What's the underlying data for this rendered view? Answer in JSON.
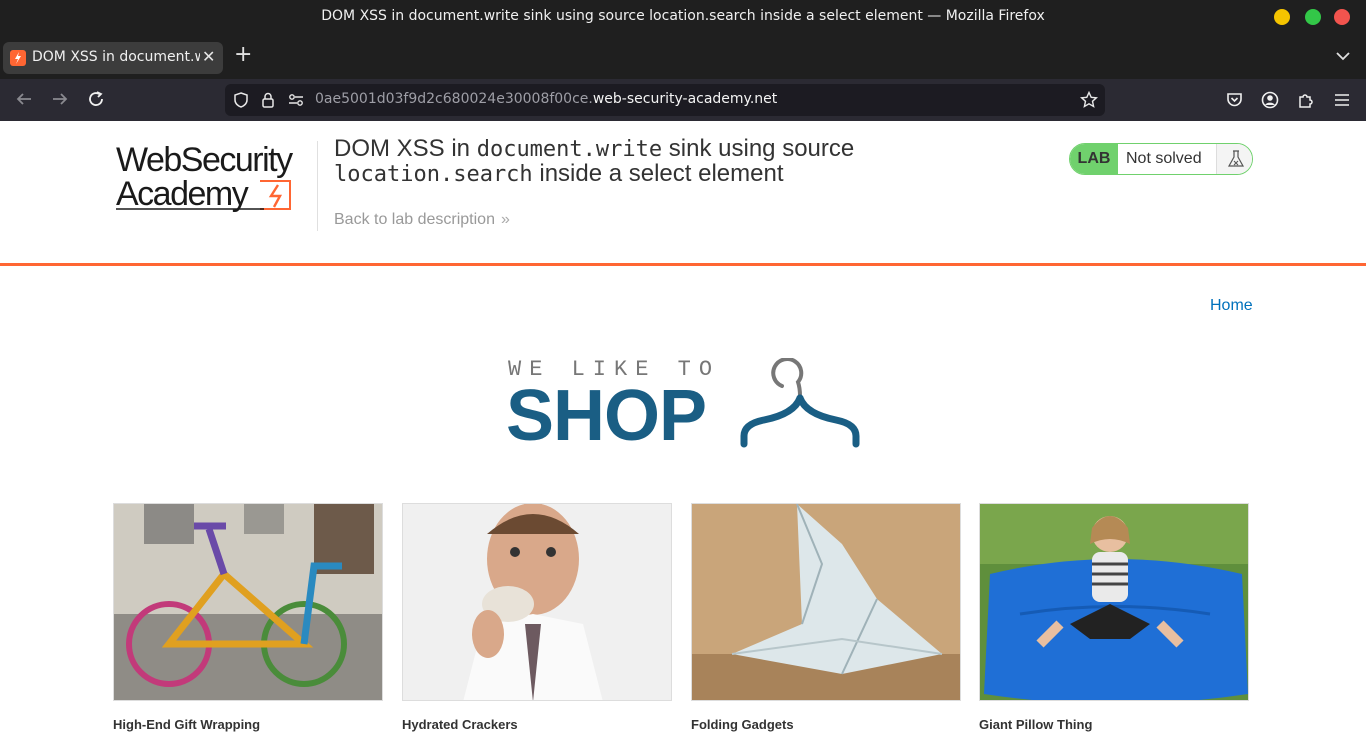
{
  "window": {
    "title": "DOM XSS in document.write sink using source location.search inside a select element — Mozilla Firefox"
  },
  "tab": {
    "label": "DOM XSS in document.write sink using source location.search inside a select element"
  },
  "urlbar": {
    "url_dim": "0ae5001d03f9d2c680024e30008f00ce.",
    "url_domain": "web-security-academy.net"
  },
  "lab": {
    "logo_line1": "WebSecurity",
    "logo_line2": "Academy",
    "title_1": "DOM XSS in ",
    "title_code_1": "document.write",
    "title_2": " sink using source",
    "title_code_2": "location.search",
    "title_3": " inside a select element",
    "back_link": "Back to lab description",
    "badge": "LAB",
    "status": "Not solved"
  },
  "shop": {
    "nav_home": "Home",
    "tagline": "WE LIKE TO",
    "brand": "SHOP",
    "products": [
      {
        "name": "High-End Gift Wrapping"
      },
      {
        "name": "Hydrated Crackers"
      },
      {
        "name": "Folding Gadgets"
      },
      {
        "name": "Giant Pillow Thing"
      }
    ]
  },
  "colors": {
    "accent": "#ff6633",
    "lab_green": "#70d16d",
    "shop_blue": "#1a5e84",
    "link_blue": "#0071bc"
  }
}
